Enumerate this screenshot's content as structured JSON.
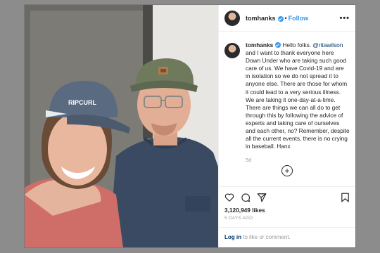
{
  "post": {
    "username": "tomhanks",
    "header_separator": "•",
    "follow_label": "Follow",
    "more_label": "•••",
    "caption": {
      "username": "tomhanks",
      "text_before_mention": "Hello folks. ",
      "mention": "@ritawilson",
      "text_after_mention": " and I want to thank everyone here Down Under who are taking such good care of us. We have Covid-19 and are in isolation so we do not spread it to anyone else. There are those for whom it could lead to a very serious illness. We are taking it one-day-at-a-time. There are things we can all do to get through this by following the advice of experts and taking care of ourselves and each other, no? Remember, despite all the current events, there is no crying in baseball. Hanx",
      "age": "5d"
    },
    "load_more_label": "+",
    "likes": "3,120,949 likes",
    "date": "5 DAYS AGO",
    "login_link": "Log in",
    "login_text": " to like or comment.",
    "photo": {
      "cap_text": "RIPCURL"
    }
  }
}
